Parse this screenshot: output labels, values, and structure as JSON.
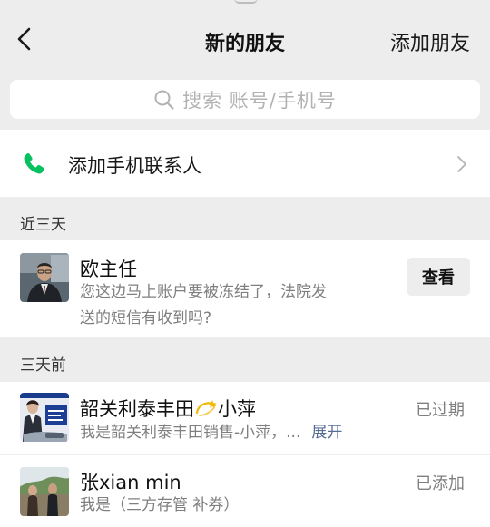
{
  "header": {
    "title": "新的朋友",
    "add_friend": "添加朋友"
  },
  "search": {
    "placeholder": "搜索 账号/手机号"
  },
  "add_contacts": {
    "label": "添加手机联系人"
  },
  "sections": {
    "recent": "近三天",
    "older": "三天前"
  },
  "requests": [
    {
      "name": "欧主任",
      "message_line1": "您这边马上账户要被冻结了，法院发",
      "message_line2": "送的短信有收到吗?",
      "action": "查看"
    },
    {
      "name_prefix": "韶关利泰丰田",
      "name_suffix": "小萍",
      "message": "我是韶关利泰丰田销售-小萍，...",
      "expand": "展开",
      "status": "已过期"
    },
    {
      "name": "张xian min",
      "message": "我是（三方存管 补券）",
      "status": "已添加"
    }
  ],
  "colors": {
    "accent_green": "#07c160",
    "link_blue": "#576b95",
    "background": "#ededed"
  }
}
